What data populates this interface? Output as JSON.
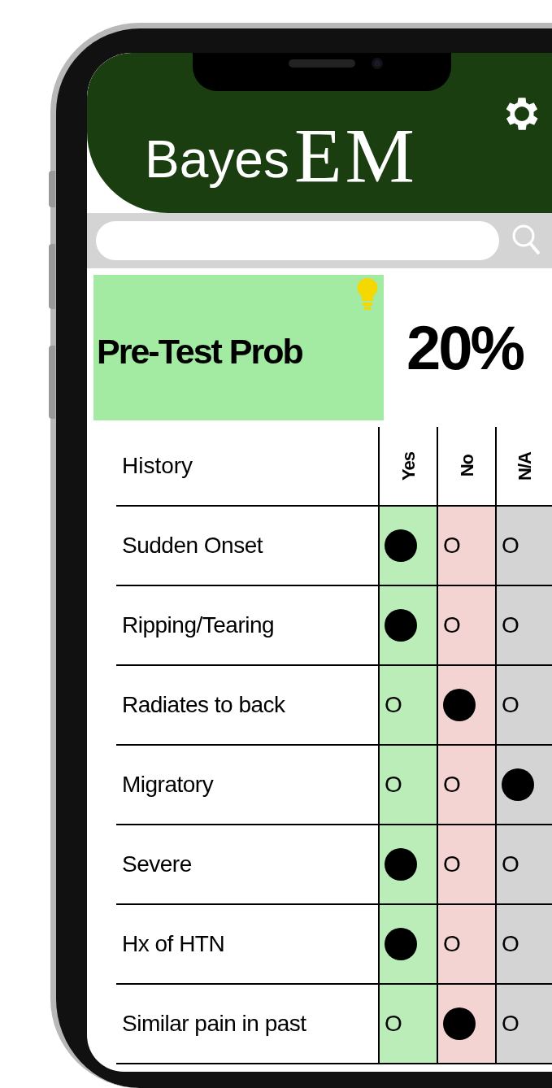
{
  "header": {
    "title_word": "Bayes",
    "title_initials": "EM"
  },
  "pretest": {
    "label": "Pre-Test Prob",
    "value": "20%"
  },
  "table": {
    "heading": "History",
    "columns": [
      {
        "label": "Yes",
        "color": "#bbedb8"
      },
      {
        "label": "No",
        "color": "#f3d4d3"
      },
      {
        "label": "N/A",
        "color": "#d4d4d4"
      }
    ],
    "rows": [
      {
        "label": "Sudden Onset",
        "options": [
          {
            "selected": true
          },
          {
            "selected": false,
            "text": "O"
          },
          {
            "selected": false,
            "text": "O"
          }
        ]
      },
      {
        "label": "Ripping/Tearing",
        "options": [
          {
            "selected": true
          },
          {
            "selected": false,
            "text": "O"
          },
          {
            "selected": false,
            "text": "O"
          }
        ]
      },
      {
        "label": "Radiates to back",
        "options": [
          {
            "selected": false,
            "text": "O"
          },
          {
            "selected": true
          },
          {
            "selected": false,
            "text": "O"
          }
        ]
      },
      {
        "label": "Migratory",
        "options": [
          {
            "selected": false,
            "text": "O"
          },
          {
            "selected": false,
            "text": "O"
          },
          {
            "selected": true
          }
        ]
      },
      {
        "label": "Severe",
        "options": [
          {
            "selected": true
          },
          {
            "selected": false,
            "text": "O"
          },
          {
            "selected": false,
            "text": "O"
          }
        ]
      },
      {
        "label": "Hx of HTN",
        "options": [
          {
            "selected": true
          },
          {
            "selected": false,
            "text": "O"
          },
          {
            "selected": false,
            "text": "O"
          }
        ]
      },
      {
        "label": "Similar pain in past",
        "options": [
          {
            "selected": false,
            "text": "O"
          },
          {
            "selected": true
          },
          {
            "selected": false,
            "text": "O"
          }
        ]
      }
    ]
  }
}
